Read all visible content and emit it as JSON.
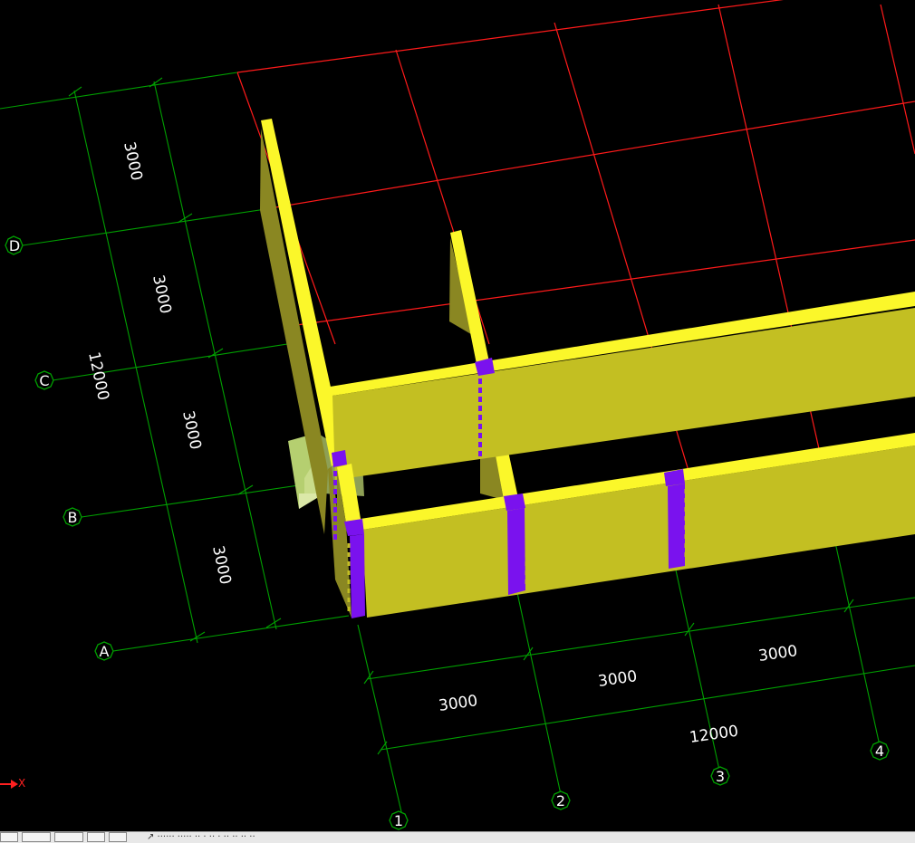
{
  "dimensions": {
    "left_bays": [
      "3000",
      "3000",
      "3000",
      "3000"
    ],
    "left_total": "12000",
    "bottom_bays": [
      "3000",
      "3000",
      "3000"
    ],
    "bottom_total": "12000"
  },
  "axes": {
    "letters": [
      "D",
      "C",
      "B",
      "A"
    ],
    "numbers": [
      "1",
      "2",
      "3",
      "4"
    ]
  },
  "ucs": {
    "x_label": "X"
  },
  "status_bar": {
    "text": "↗ ······ ····· ·· · ·· · ·· ·· ·· ··"
  },
  "colors": {
    "background": "#000000",
    "grid_red": "#ff1a1a",
    "grid_green": "#00a000",
    "wall_top": "#fbf72a",
    "wall_face": "#c3bf22",
    "wall_side": "#8a8722",
    "column": "#7a12ee",
    "foundation": "#b5cf70"
  }
}
